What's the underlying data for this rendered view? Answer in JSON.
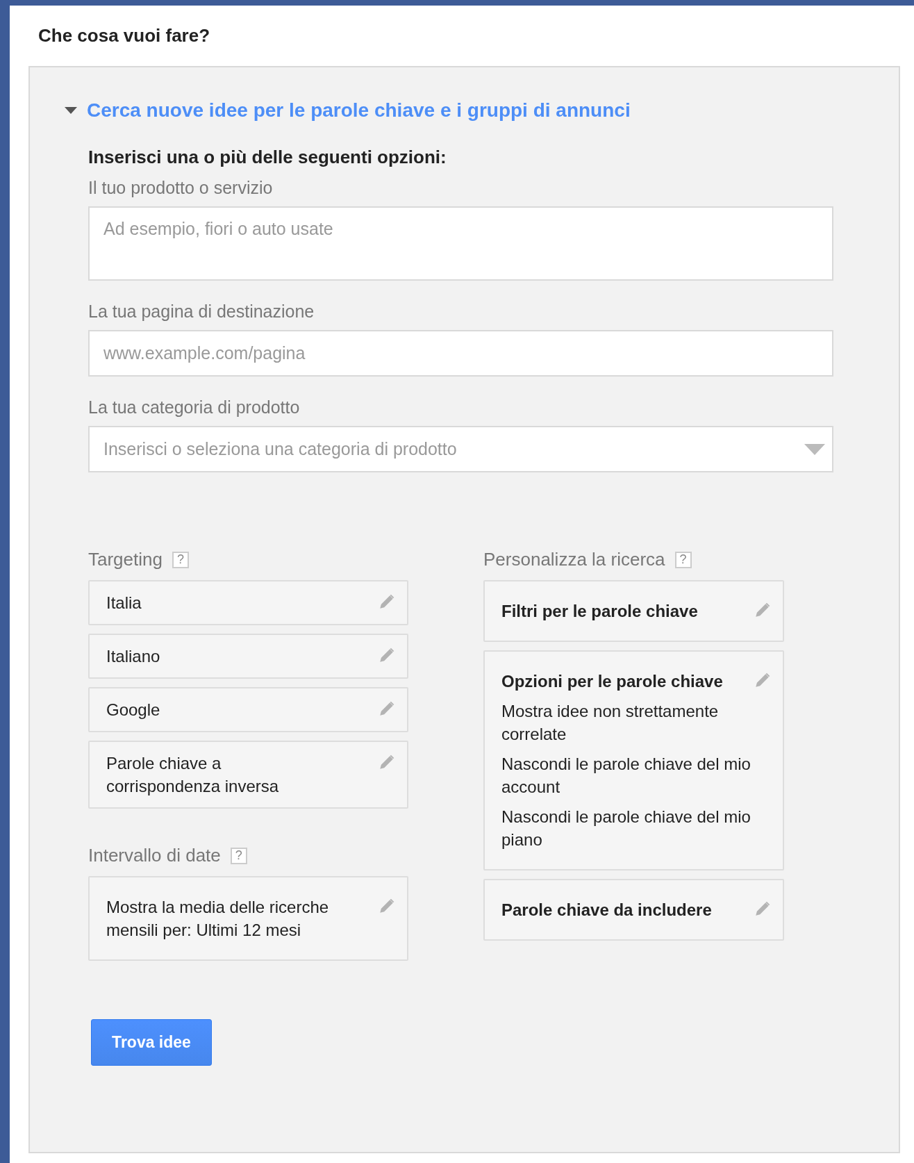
{
  "page": {
    "title": "Che cosa vuoi fare?"
  },
  "section": {
    "title": "Cerca nuove idee per le parole chiave e i gruppi di annunci",
    "expanded": true,
    "instruction": "Inserisci una o più delle seguenti opzioni:"
  },
  "fields": [
    {
      "kind": "textarea",
      "label": "Il tuo prodotto o servizio",
      "placeholder": "Ad esempio, fiori o auto usate"
    },
    {
      "kind": "text",
      "label": "La tua pagina di destinazione",
      "placeholder": "www.example.com/pagina"
    },
    {
      "kind": "select",
      "label": "La tua categoria di prodotto",
      "placeholder": "Inserisci o seleziona una categoria di prodotto"
    }
  ],
  "targeting": {
    "label": "Targeting",
    "help": "?",
    "items": [
      "Italia",
      "Italiano",
      "Google",
      "Parole chiave a corrispondenza inversa"
    ]
  },
  "date_range": {
    "label": "Intervallo di date",
    "help": "?",
    "text": "Mostra la media delle ricerche mensili per: Ultimi 12 mesi"
  },
  "customize": {
    "label": "Personalizza la ricerca",
    "help": "?",
    "cards": [
      {
        "title": "Filtri per le parole chiave"
      },
      {
        "title": "Opzioni per le parole chiave",
        "lines": [
          "Mostra idee non strettamente correlate",
          "Nascondi le parole chiave del mio account",
          "Nascondi le parole chiave del mio piano"
        ]
      },
      {
        "title": "Parole chiave da includere"
      }
    ]
  },
  "button": "Trova idee"
}
